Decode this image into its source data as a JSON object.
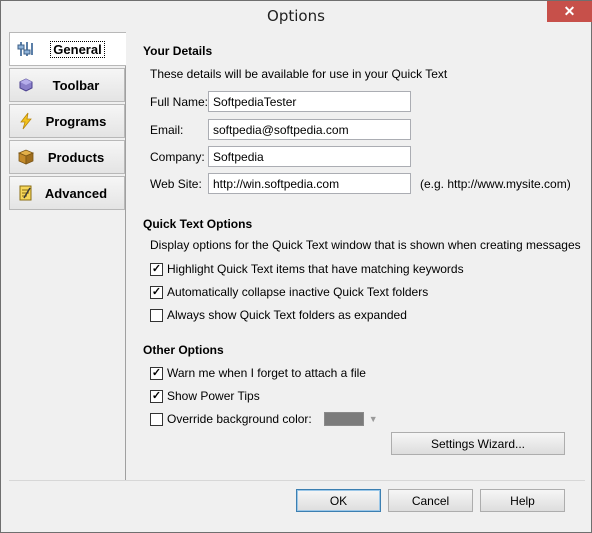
{
  "window": {
    "title": "Options",
    "close_glyph": "✕"
  },
  "tabs": [
    {
      "label": "General",
      "icon": "general-settings-icon",
      "active": true
    },
    {
      "label": "Toolbar",
      "icon": "toolbar-icon",
      "active": false
    },
    {
      "label": "Programs",
      "icon": "lightning-icon",
      "active": false
    },
    {
      "label": "Products",
      "icon": "box-icon",
      "active": false
    },
    {
      "label": "Advanced",
      "icon": "notepad-icon",
      "active": false
    }
  ],
  "your_details": {
    "title": "Your Details",
    "description": "These details will be available for use in your Quick Text",
    "full_name_label": "Full Name:",
    "full_name_value": "SoftpediaTester",
    "email_label": "Email:",
    "email_value": "softpedia@softpedia.com",
    "company_label": "Company:",
    "company_value": "Softpedia",
    "website_label": "Web Site:",
    "website_value": "http://win.softpedia.com",
    "website_hint": "(e.g. http://www.mysite.com)"
  },
  "quick_text_options": {
    "title": "Quick Text Options",
    "description": "Display options for the Quick Text window that is shown when creating messages",
    "options": [
      {
        "label": "Highlight Quick Text items that have matching keywords",
        "checked": true
      },
      {
        "label": "Automatically collapse inactive Quick Text folders",
        "checked": true
      },
      {
        "label": "Always show Quick Text folders as expanded",
        "checked": false
      }
    ]
  },
  "other_options": {
    "title": "Other Options",
    "options": [
      {
        "label": "Warn me when I forget to attach a file",
        "checked": true
      },
      {
        "label": "Show Power Tips",
        "checked": true
      },
      {
        "label": "Override background color:",
        "checked": false
      }
    ],
    "background_color": "#7b7b7b",
    "settings_wizard_label": "Settings Wizard..."
  },
  "buttons": {
    "ok": "OK",
    "cancel": "Cancel",
    "help": "Help"
  }
}
